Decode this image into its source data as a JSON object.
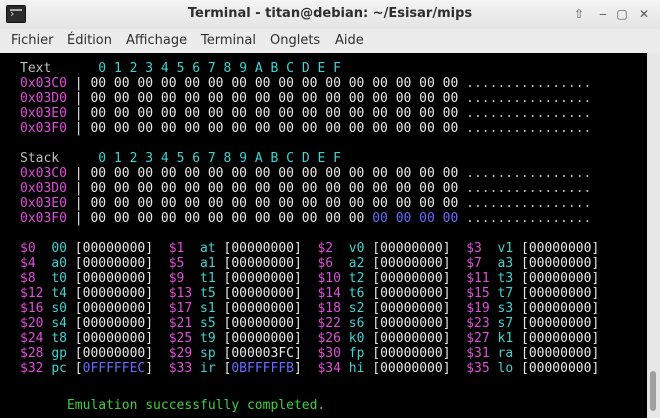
{
  "window": {
    "title": "Terminal - titan@debian: ~/Esisar/mips",
    "buttons": [
      "⇧",
      "‒",
      "▢",
      "✕"
    ]
  },
  "menu": [
    "Fichier",
    "Édition",
    "Affichage",
    "Terminal",
    "Onglets",
    "Aide"
  ],
  "hex_header": [
    "0",
    "1",
    "2",
    "3",
    "4",
    "5",
    "6",
    "7",
    "8",
    "9",
    "A",
    "B",
    "C",
    "D",
    "E",
    "F"
  ],
  "text_section": {
    "label": "Text",
    "rows": [
      {
        "addr_prefix": "0x",
        "addr": "03C0",
        "bytes": "00 00 00 00 00 00 00 00 00 00 00 00 00 00 00 00",
        "ascii": "................"
      },
      {
        "addr_prefix": "0x",
        "addr": "03D0",
        "bytes": "00 00 00 00 00 00 00 00 00 00 00 00 00 00 00 00",
        "ascii": "................"
      },
      {
        "addr_prefix": "0x",
        "addr": "03E0",
        "bytes": "00 00 00 00 00 00 00 00 00 00 00 00 00 00 00 00",
        "ascii": "................"
      },
      {
        "addr_prefix": "0x",
        "addr": "03F0",
        "bytes": "00 00 00 00 00 00 00 00 00 00 00 00 00 00 00 00",
        "ascii": "................"
      }
    ]
  },
  "stack_section": {
    "label": "Stack",
    "rows": [
      {
        "addr_prefix": "0x",
        "addr": "03C0",
        "bytes": "00 00 00 00 00 00 00 00 00 00 00 00 00 00 00 00",
        "hl": "",
        "ascii": "................"
      },
      {
        "addr_prefix": "0x",
        "addr": "03D0",
        "bytes": "00 00 00 00 00 00 00 00 00 00 00 00 00 00 00 00",
        "hl": "",
        "ascii": "................"
      },
      {
        "addr_prefix": "0x",
        "addr": "03E0",
        "bytes": "00 00 00 00 00 00 00 00 00 00 00 00 00 00 00 00",
        "hl": "",
        "ascii": "................"
      },
      {
        "addr_prefix": "0x",
        "addr": "03F0",
        "bytes": "00 00 00 00 00 00 00 00 00 00 00 00",
        "hl": " 00 00 00 00",
        "ascii": "................"
      }
    ]
  },
  "registers": [
    [
      {
        "num": "$0",
        "name": "00",
        "val": "00000000"
      },
      {
        "num": "$1",
        "name": "at",
        "val": "00000000"
      },
      {
        "num": "$2",
        "name": "v0",
        "val": "00000000"
      },
      {
        "num": "$3",
        "name": "v1",
        "val": "00000000"
      }
    ],
    [
      {
        "num": "$4",
        "name": "a0",
        "val": "00000000"
      },
      {
        "num": "$5",
        "name": "a1",
        "val": "00000000"
      },
      {
        "num": "$6",
        "name": "a2",
        "val": "00000000"
      },
      {
        "num": "$7",
        "name": "a3",
        "val": "00000000"
      }
    ],
    [
      {
        "num": "$8",
        "name": "t0",
        "val": "00000000"
      },
      {
        "num": "$9",
        "name": "t1",
        "val": "00000000"
      },
      {
        "num": "$10",
        "name": "t2",
        "val": "00000000"
      },
      {
        "num": "$11",
        "name": "t3",
        "val": "00000000"
      }
    ],
    [
      {
        "num": "$12",
        "name": "t4",
        "val": "00000000"
      },
      {
        "num": "$13",
        "name": "t5",
        "val": "00000000"
      },
      {
        "num": "$14",
        "name": "t6",
        "val": "00000000"
      },
      {
        "num": "$15",
        "name": "t7",
        "val": "00000000"
      }
    ],
    [
      {
        "num": "$16",
        "name": "s0",
        "val": "00000000"
      },
      {
        "num": "$17",
        "name": "s1",
        "val": "00000000"
      },
      {
        "num": "$18",
        "name": "s2",
        "val": "00000000"
      },
      {
        "num": "$19",
        "name": "s3",
        "val": "00000000"
      }
    ],
    [
      {
        "num": "$20",
        "name": "s4",
        "val": "00000000"
      },
      {
        "num": "$21",
        "name": "s5",
        "val": "00000000"
      },
      {
        "num": "$22",
        "name": "s6",
        "val": "00000000"
      },
      {
        "num": "$23",
        "name": "s7",
        "val": "00000000"
      }
    ],
    [
      {
        "num": "$24",
        "name": "t8",
        "val": "00000000"
      },
      {
        "num": "$25",
        "name": "t9",
        "val": "00000000"
      },
      {
        "num": "$26",
        "name": "k0",
        "val": "00000000"
      },
      {
        "num": "$27",
        "name": "k1",
        "val": "00000000"
      }
    ],
    [
      {
        "num": "$28",
        "name": "gp",
        "val": "00000000"
      },
      {
        "num": "$29",
        "name": "sp",
        "val": "000003FC"
      },
      {
        "num": "$30",
        "name": "fp",
        "val": "00000000"
      },
      {
        "num": "$31",
        "name": "ra",
        "val": "00000000"
      }
    ],
    [
      {
        "num": "$32",
        "name": "pc",
        "val": "0FFFFFEC",
        "hl": true
      },
      {
        "num": "$33",
        "name": "ir",
        "val": "0BFFFFFB",
        "hl": true
      },
      {
        "num": "$34",
        "name": "hi",
        "val": "00000000"
      },
      {
        "num": "$35",
        "name": "lo",
        "val": "00000000"
      }
    ]
  ],
  "status": "Emulation successfully completed.",
  "colors": {
    "cyan": "#3fd3d3",
    "magenta": "#e04fd8",
    "blue": "#6a6afc",
    "green": "#3fcf3f"
  }
}
